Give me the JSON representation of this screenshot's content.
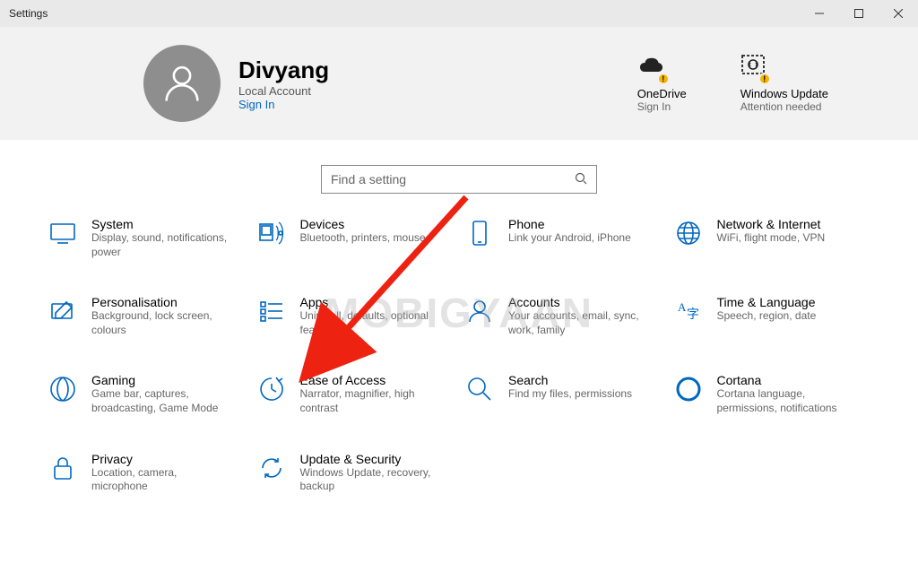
{
  "window": {
    "title": "Settings"
  },
  "header": {
    "profile": {
      "name": "Divyang",
      "account_type": "Local Account",
      "signin": "Sign In"
    },
    "onedrive": {
      "label": "OneDrive",
      "sub": "Sign In"
    },
    "windows_update": {
      "label": "Windows Update",
      "sub": "Attention needed"
    }
  },
  "search": {
    "placeholder": "Find a setting"
  },
  "categories": [
    {
      "id": "system",
      "title": "System",
      "sub": "Display, sound, notifications, power"
    },
    {
      "id": "devices",
      "title": "Devices",
      "sub": "Bluetooth, printers, mouse"
    },
    {
      "id": "phone",
      "title": "Phone",
      "sub": "Link your Android, iPhone"
    },
    {
      "id": "network",
      "title": "Network & Internet",
      "sub": "WiFi, flight mode, VPN"
    },
    {
      "id": "personalisation",
      "title": "Personalisation",
      "sub": "Background, lock screen, colours"
    },
    {
      "id": "apps",
      "title": "Apps",
      "sub": "Uninstall, defaults, optional features"
    },
    {
      "id": "accounts",
      "title": "Accounts",
      "sub": "Your accounts, email, sync, work, family"
    },
    {
      "id": "time_language",
      "title": "Time & Language",
      "sub": "Speech, region, date"
    },
    {
      "id": "gaming",
      "title": "Gaming",
      "sub": "Game bar, captures, broadcasting, Game Mode"
    },
    {
      "id": "ease_of_access",
      "title": "Ease of Access",
      "sub": "Narrator, magnifier, high contrast"
    },
    {
      "id": "search",
      "title": "Search",
      "sub": "Find my files, permissions"
    },
    {
      "id": "cortana",
      "title": "Cortana",
      "sub": "Cortana language, permissions, notifications"
    },
    {
      "id": "privacy",
      "title": "Privacy",
      "sub": "Location, camera, microphone"
    },
    {
      "id": "update_security",
      "title": "Update & Security",
      "sub": "Windows Update, recovery, backup"
    }
  ],
  "watermark": "MOBIGYAAN",
  "icon_color": "#0067c0"
}
